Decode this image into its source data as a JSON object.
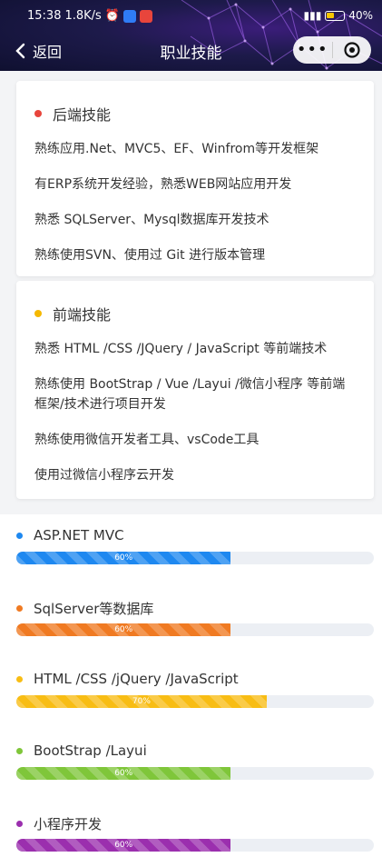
{
  "status": {
    "time": "15:38",
    "speed": "1.8K/s",
    "battery": "40%"
  },
  "nav": {
    "back_label": "返回",
    "title": "职业技能",
    "menu_dots": "•••"
  },
  "backend": {
    "title": "后端技能",
    "dot_color": "#e8453c",
    "lines": [
      "熟练应用.Net、MVC5、EF、Winfrom等开发框架",
      "有ERP系统开发经验，熟悉WEB网站应用开发",
      "熟悉 SQLServer、Mysql数据库开发技术",
      "熟练使用SVN、使用过 Git 进行版本管理"
    ]
  },
  "frontend": {
    "title": "前端技能",
    "dot_color": "#f5b800",
    "lines": [
      "熟悉 HTML /CSS /JQuery / JavaScript 等前端技术",
      "熟练使用 BootStrap / Vue /Layui /微信小程序 等前端框架/技术进行项目开发",
      "熟练使用微信开发者工具、vsCode工具",
      "使用过微信小程序云开发"
    ]
  },
  "skills": [
    {
      "name": "ASP.NET MVC",
      "percent": 60,
      "label": "60%",
      "color": "#1e88f0"
    },
    {
      "name": "SqlServer等数据库",
      "percent": 60,
      "label": "60%",
      "color": "#f07a22"
    },
    {
      "name": "HTML /CSS /jQuery /JavaScript",
      "percent": 70,
      "label": "70%",
      "color": "#f8bd14"
    },
    {
      "name": "BootStrap /Layui",
      "percent": 60,
      "label": "60%",
      "color": "#7fc63a"
    },
    {
      "name": "小程序开发",
      "percent": 60,
      "label": "60%",
      "color": "#9b2fae"
    }
  ]
}
